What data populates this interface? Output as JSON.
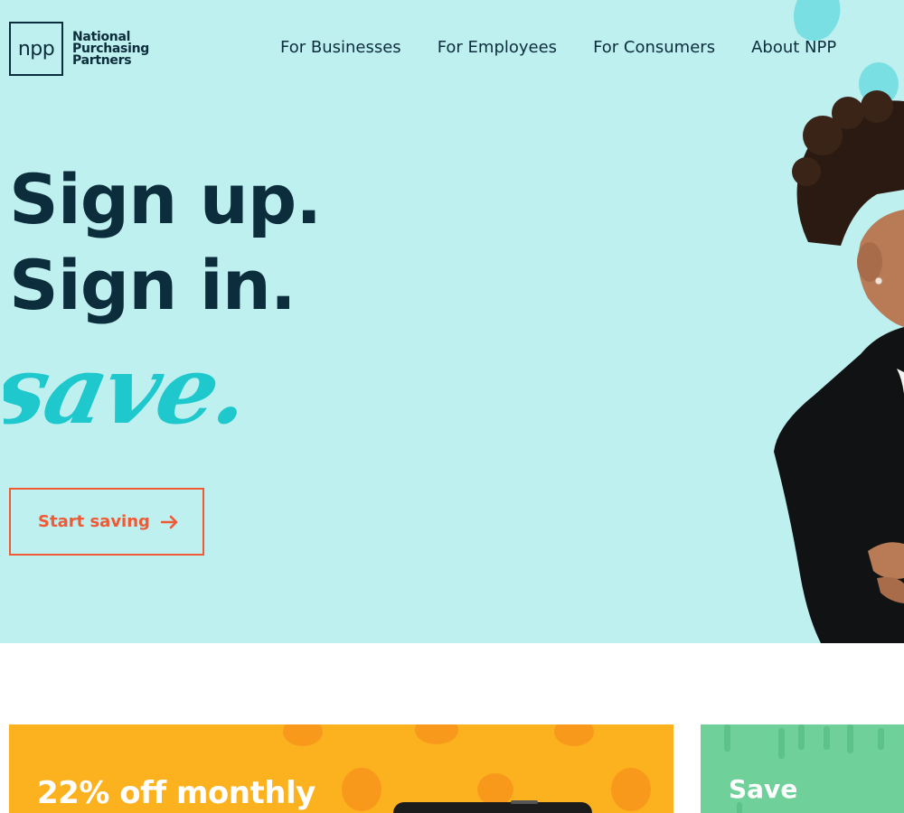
{
  "brand": {
    "logo_mark": "npp",
    "name_lines": [
      "National",
      "Purchasing",
      "Partners"
    ]
  },
  "nav": {
    "items": [
      {
        "label": "For Businesses"
      },
      {
        "label": "For Employees"
      },
      {
        "label": "For Consumers"
      },
      {
        "label": "About NPP"
      }
    ]
  },
  "hero": {
    "headline_line1": "Sign up.",
    "headline_line2": "Sign in.",
    "script_word": "save.",
    "cta_label": "Start saving",
    "cta_icon": "arrow-right-icon"
  },
  "cards": {
    "orange_title": "22% off monthly",
    "green_title": "Save"
  },
  "colors": {
    "hero_bg": "#bff0f0",
    "ink": "#0c2d3b",
    "script_teal": "#1fc8cc",
    "accent_orange": "#ef5a35",
    "card_orange": "#fcb11e",
    "card_green": "#6fd09a"
  }
}
